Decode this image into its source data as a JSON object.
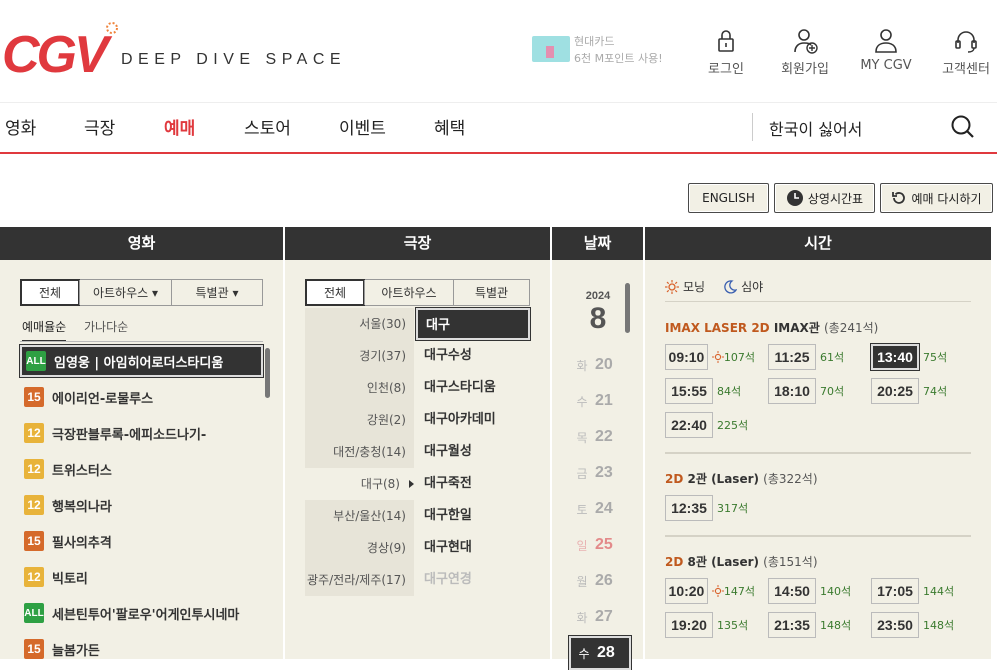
{
  "header": {
    "tagline": "DEEP DIVE SPACE",
    "promo": {
      "line1": "현대카드",
      "line2": "6천 M포인트 사용!"
    },
    "top_nav": [
      {
        "label": "로그인",
        "icon": "lock-icon"
      },
      {
        "label": "회원가입",
        "icon": "user-add-icon"
      },
      {
        "label": "MY CGV",
        "icon": "user-icon"
      },
      {
        "label": "고객센터",
        "icon": "headset-icon"
      }
    ]
  },
  "gnb": {
    "items": [
      "영화",
      "극장",
      "예매",
      "스토어",
      "이벤트",
      "혜택"
    ],
    "active_index": 2,
    "search_value": "한국이 싫어서"
  },
  "toolbar": {
    "english": "ENGLISH",
    "schedule": "상영시간표",
    "reset": "예매 다시하기"
  },
  "columns": {
    "movie": "영화",
    "theater": "극장",
    "date": "날짜",
    "time": "시간"
  },
  "movie_panel": {
    "tabs": [
      "전체",
      "아트하우스 ▾",
      "특별관 ▾"
    ],
    "sort": [
      "예매율순",
      "가나다순"
    ],
    "movies": [
      {
        "rating": "ALL",
        "title": "임영웅 | 아임히어로더스타디움",
        "selected": true
      },
      {
        "rating": "15",
        "title": "에이리언-로물루스"
      },
      {
        "rating": "12",
        "title": "극장판블루록-에피소드나기-"
      },
      {
        "rating": "12",
        "title": "트위스터스"
      },
      {
        "rating": "12",
        "title": "행복의나라"
      },
      {
        "rating": "15",
        "title": "필사의추격"
      },
      {
        "rating": "12",
        "title": "빅토리"
      },
      {
        "rating": "ALL",
        "title": "세븐틴투어'팔로우'어게인투시네마"
      },
      {
        "rating": "15",
        "title": "늘봄가든"
      }
    ]
  },
  "theater_panel": {
    "tabs": [
      "전체",
      "아트하우스",
      "특별관"
    ],
    "regions": [
      "서울(30)",
      "경기(37)",
      "인천(8)",
      "강원(2)",
      "대전/충청(14)",
      "대구(8)",
      "부산/울산(14)",
      "경상(9)",
      "광주/전라/제주(17)"
    ],
    "selected_region_index": 5,
    "theaters": [
      {
        "name": "대구",
        "state": "selected"
      },
      {
        "name": "대구수성",
        "state": "normal"
      },
      {
        "name": "대구스타디움",
        "state": "normal"
      },
      {
        "name": "대구아카데미",
        "state": "normal"
      },
      {
        "name": "대구월성",
        "state": "normal"
      },
      {
        "name": "대구죽전",
        "state": "normal"
      },
      {
        "name": "대구한일",
        "state": "normal"
      },
      {
        "name": "대구현대",
        "state": "normal"
      },
      {
        "name": "대구연경",
        "state": "disabled"
      }
    ]
  },
  "date_panel": {
    "year": "2024",
    "month": "8",
    "days": [
      {
        "weekday": "화",
        "day": "20"
      },
      {
        "weekday": "수",
        "day": "21"
      },
      {
        "weekday": "목",
        "day": "22"
      },
      {
        "weekday": "금",
        "day": "23"
      },
      {
        "weekday": "토",
        "day": "24"
      },
      {
        "weekday": "일",
        "day": "25",
        "sunday": true
      },
      {
        "weekday": "월",
        "day": "26"
      },
      {
        "weekday": "화",
        "day": "27"
      },
      {
        "weekday": "수",
        "day": "28",
        "selected": true
      }
    ]
  },
  "time_panel": {
    "legend": {
      "morning": "모닝",
      "night": "심야"
    },
    "sections": [
      {
        "format": "IMAX LASER 2D",
        "hall": "IMAX관",
        "capacity": "(총241석)",
        "slots": [
          {
            "time": "09:10",
            "seats": "107석",
            "morning": true
          },
          {
            "time": "11:25",
            "seats": "61석"
          },
          {
            "time": "13:40",
            "seats": "75석",
            "selected": true
          },
          {
            "time": "15:55",
            "seats": "84석"
          },
          {
            "time": "18:10",
            "seats": "70석"
          },
          {
            "time": "20:25",
            "seats": "74석"
          },
          {
            "time": "22:40",
            "seats": "225석"
          }
        ]
      },
      {
        "format": "2D",
        "hall": "2관 (Laser)",
        "capacity": "(총322석)",
        "slots": [
          {
            "time": "12:35",
            "seats": "317석"
          }
        ]
      },
      {
        "format": "2D",
        "hall": "8관 (Laser)",
        "capacity": "(총151석)",
        "slots": [
          {
            "time": "10:20",
            "seats": "147석",
            "morning": true
          },
          {
            "time": "14:50",
            "seats": "140석"
          },
          {
            "time": "17:05",
            "seats": "144석"
          },
          {
            "time": "19:20",
            "seats": "135석"
          },
          {
            "time": "21:35",
            "seats": "148석"
          },
          {
            "time": "23:50",
            "seats": "148석"
          }
        ]
      }
    ]
  },
  "colors": {
    "brand_red": "#e0393e",
    "dark": "#333333",
    "panel_bg": "#f2f0e5",
    "seat_green": "#3a7a2e",
    "format_orange": "#c0591e"
  }
}
